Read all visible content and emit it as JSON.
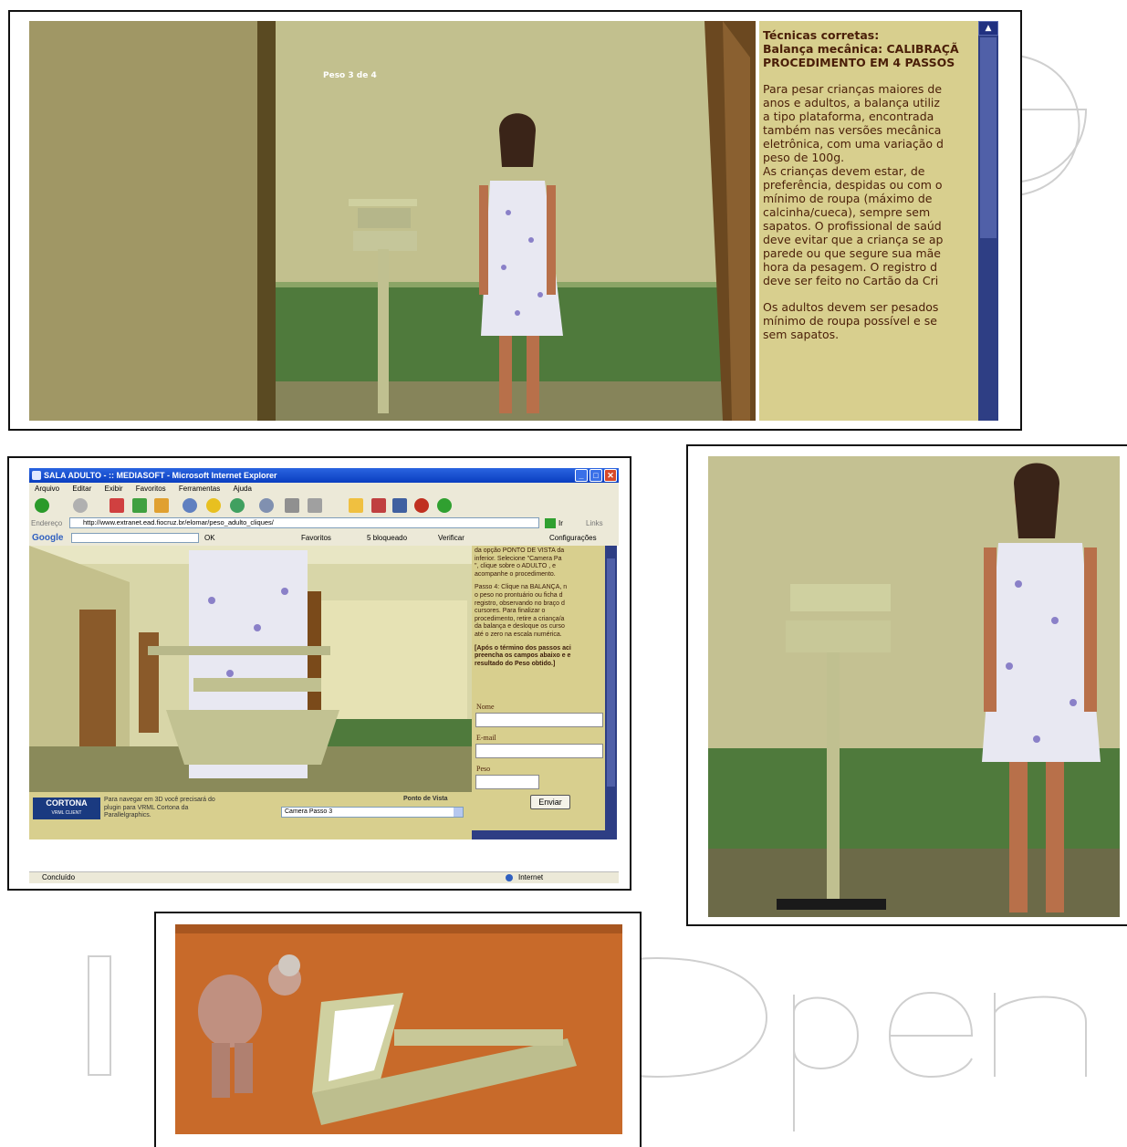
{
  "watermark": {
    "text": "IntechOpen"
  },
  "top_scene": {
    "overlay_label": "Peso 3 de 4",
    "panel_title": "Técnicas corretas:\nBalança mecânica: CALIBRAÇÃ\nPROCEDIMENTO EM 4 PASSOS",
    "panel_paragraph_1": "Para pesar crianças maiores de\nanos e adultos, a balança utiliz\na tipo plataforma, encontrada\ntambém nas versões mecânica\neletrônica, com uma variação d\npeso de 100g.\nAs crianças devem estar, de\npreferência, despidas ou com o\nmínimo de roupa (máximo de\ncalcinha/cueca), sempre sem\nsapatos. O profissional de saúd\ndeve evitar que a criança se ap\nparede ou que segure sua mãe\nhora da pesagem. O registro d\ndeve ser feito no Cartão da Cri",
    "panel_paragraph_2": "Os adultos devem ser pesados\nmínimo de roupa possível e se\nsem sapatos."
  },
  "browser": {
    "window_title": "SALA ADULTO - :: MEDIASOFT - Microsoft Internet Explorer",
    "menu": [
      "Arquivo",
      "Editar",
      "Exibir",
      "Favoritos",
      "Ferramentas",
      "Ajuda"
    ],
    "address_label": "Endereço",
    "address_url": "http://www.extranet.ead.fiocruz.br/elomar/peso_adulto_cliques/",
    "go_label": "Ir",
    "links_label": "Links",
    "google_label": "Google",
    "google_items": [
      "OK",
      "Favoritos",
      "5 bloqueado",
      "Verificar",
      "Configurações"
    ],
    "side_para_1": "da opção PONTO DE VISTA da\ninferior. Selecione \"Camera Pa\n\", clique sobre o ADULTO , e\nacompanhe o procedimento.",
    "side_para_2": "Passo 4: Clique na BALANÇA, n\no peso no prontuário ou ficha d\nregistro, observando no braço d\ncursores. Para finalizar o\nprocedimento, retire a criança/a\nda balança e desloque os curso\naté o zero na escala numérica.",
    "side_para_3": "[Após o término dos passos aci\npreencha os campos abaixo e e\nresultado do Peso obtido.]",
    "label_nome": "Nome",
    "label_email": "E-mail",
    "label_peso": "Peso",
    "submit_label": "Enviar",
    "cortona_logo": "CORTONA",
    "cortona_sub": "VRML CLIENT",
    "cortona_text": "Para navegar em 3D você precisará do\nplugin para VRML Cortona da\nParallelgraphics.",
    "viewpoint_label": "Ponto de Vista",
    "viewpoint_value": "Camera Passo 3",
    "status_left": "Concluído",
    "status_right": "Internet"
  },
  "colors": {
    "panel_bg": "#d8cf8e",
    "panel_text": "#4a1e08",
    "scrollbar": "#2e3e84",
    "xp_title": "#0a3ec0"
  }
}
